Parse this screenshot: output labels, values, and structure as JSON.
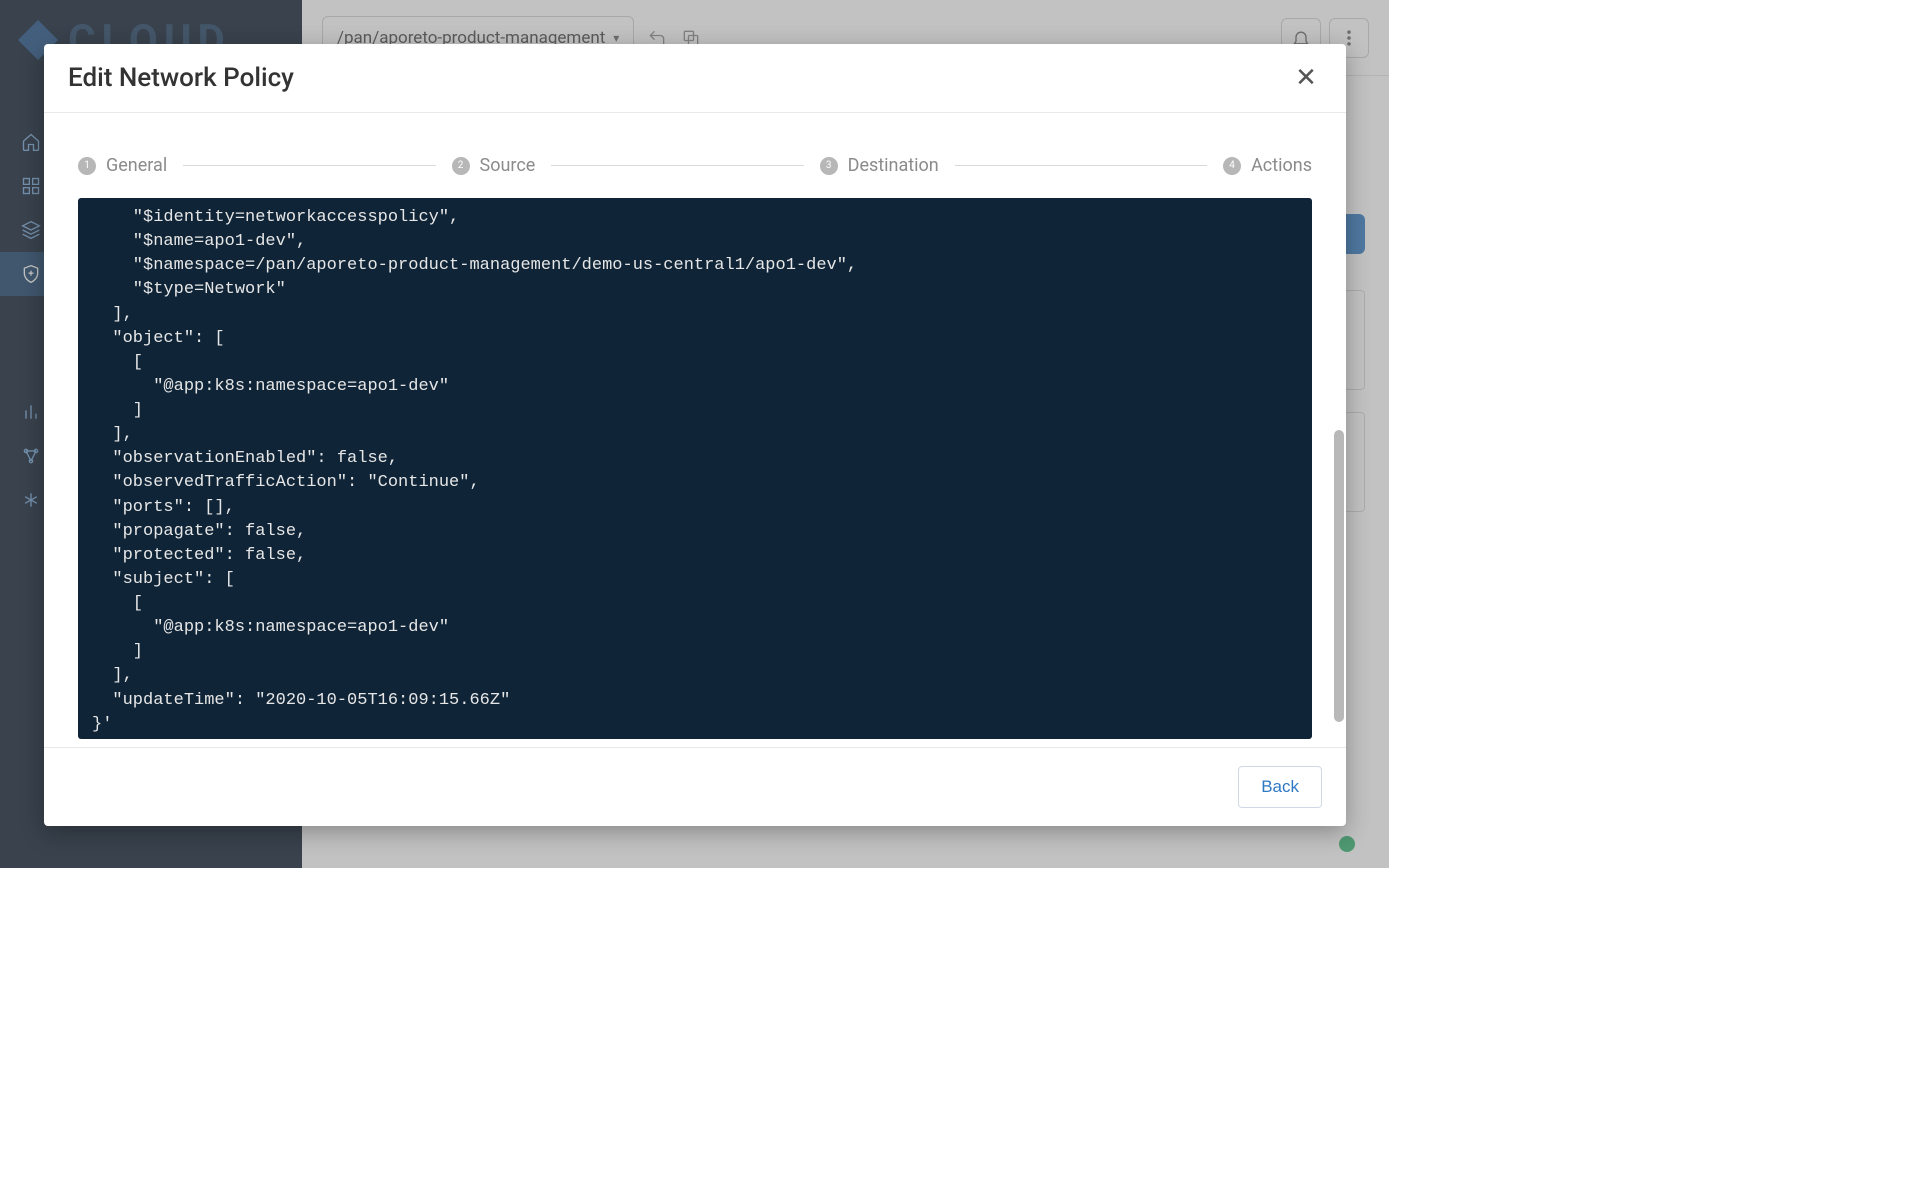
{
  "topbar": {
    "breadcrumb": "/pan/aporeto-product-management"
  },
  "sidebar": {
    "logo_text": "CLOUD"
  },
  "modal": {
    "title": "Edit Network Policy",
    "steps": [
      {
        "num": "1",
        "label": "General"
      },
      {
        "num": "2",
        "label": "Source"
      },
      {
        "num": "3",
        "label": "Destination"
      },
      {
        "num": "4",
        "label": "Actions"
      }
    ],
    "code": "    \"$identity=networkaccesspolicy\",\n    \"$name=apo1-dev\",\n    \"$namespace=/pan/aporeto-product-management/demo-us-central1/apo1-dev\",\n    \"$type=Network\"\n  ],\n  \"object\": [\n    [\n      \"@app:k8s:namespace=apo1-dev\"\n    ]\n  ],\n  \"observationEnabled\": false,\n  \"observedTrafficAction\": \"Continue\",\n  \"ports\": [],\n  \"propagate\": false,\n  \"protected\": false,\n  \"subject\": [\n    [\n      \"@app:k8s:namespace=apo1-dev\"\n    ]\n  ],\n  \"updateTime\": \"2020-10-05T16:09:15.66Z\"\n}'",
    "back_label": "Back"
  }
}
